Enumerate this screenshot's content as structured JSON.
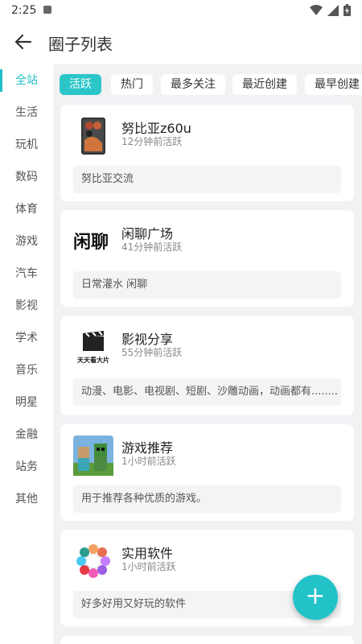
{
  "status": {
    "time": "2:25"
  },
  "header": {
    "title": "圈子列表"
  },
  "sidebar": {
    "items": [
      {
        "label": "全站"
      },
      {
        "label": "生活"
      },
      {
        "label": "玩机"
      },
      {
        "label": "数码"
      },
      {
        "label": "体育"
      },
      {
        "label": "游戏"
      },
      {
        "label": "汽车"
      },
      {
        "label": "影视"
      },
      {
        "label": "学术"
      },
      {
        "label": "音乐"
      },
      {
        "label": "明星"
      },
      {
        "label": "金融"
      },
      {
        "label": "站务"
      },
      {
        "label": "其他"
      }
    ]
  },
  "tabs": [
    {
      "label": "活跃"
    },
    {
      "label": "热门"
    },
    {
      "label": "最多关注"
    },
    {
      "label": "最近创建"
    },
    {
      "label": "最早创建"
    }
  ],
  "cards": [
    {
      "name": "努比亚z60u",
      "active": "12分钟前活跃",
      "desc": "努比亚交流"
    },
    {
      "name": "闲聊广场",
      "active": "41分钟前活跃",
      "desc": "日常灌水 闲聊",
      "logo_text": "闲聊"
    },
    {
      "name": "影视分享",
      "active": "55分钟前活跃",
      "desc": "动漫、电影、电视剧、短剧、沙雕动画，动画都有........",
      "logo_text": "天天看大片"
    },
    {
      "name": "游戏推荐",
      "active": "1小时前活跃",
      "desc": "用于推荐各种优质的游戏。"
    },
    {
      "name": "实用软件",
      "active": "1小时前活跃",
      "desc": "好多好用又好玩的软件"
    }
  ],
  "colors": {
    "accent": "#22c3c8",
    "background": "#f2f2f5"
  },
  "fab": {
    "label": "+"
  }
}
